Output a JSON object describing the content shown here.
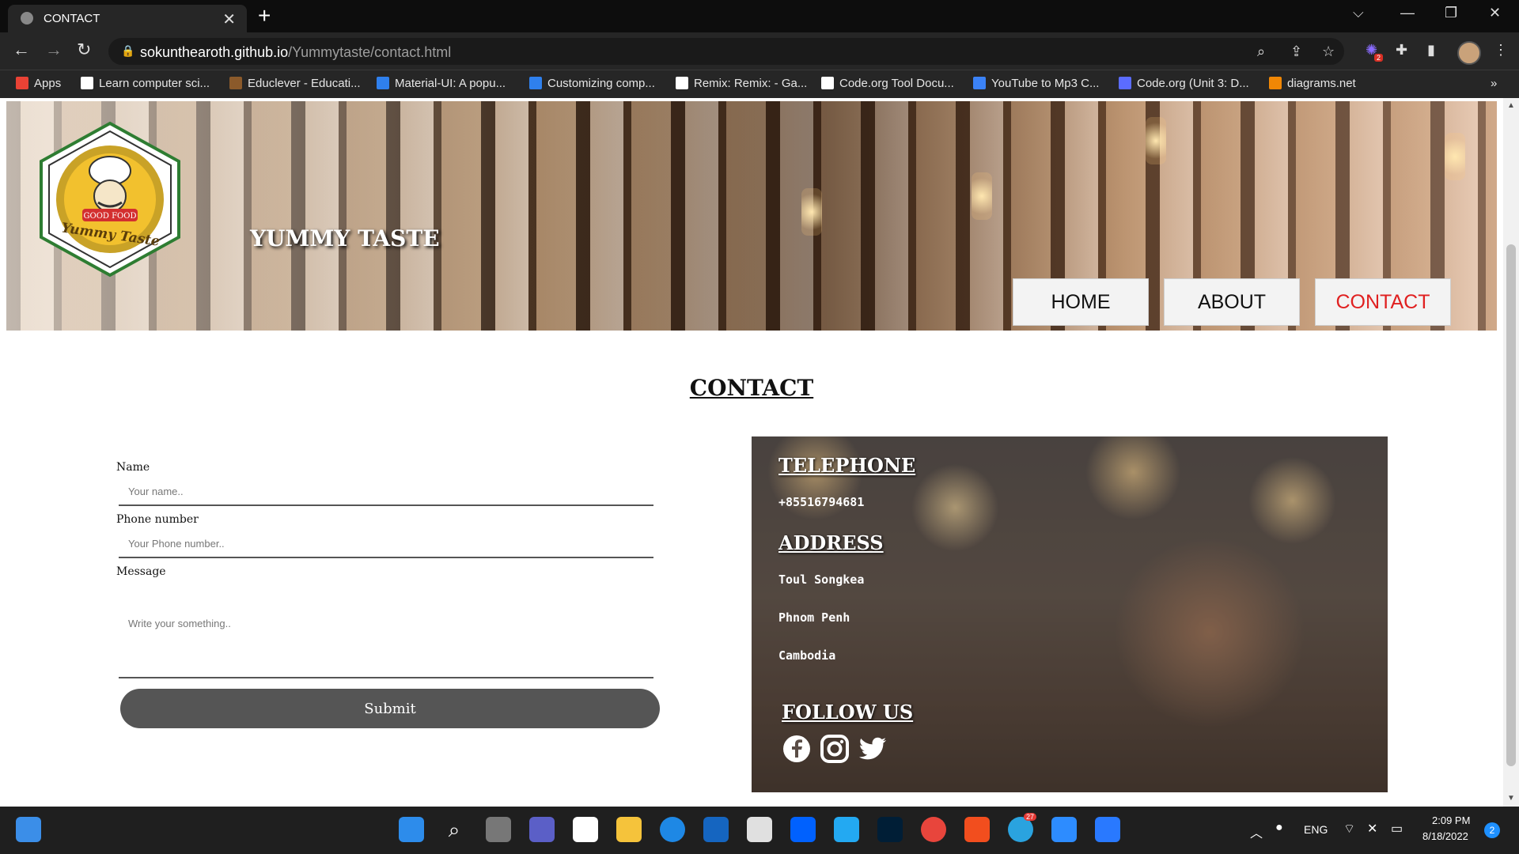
{
  "browser": {
    "tab_title": "CONTACT",
    "url_host": "sokunthearoth.github.io",
    "url_path": "/Yummytaste/contact.html",
    "bookmarks": [
      {
        "label": "Apps",
        "color": "#e94235"
      },
      {
        "label": "Learn computer sci...",
        "color": "#ffffff"
      },
      {
        "label": "Educlever - Educati...",
        "color": "#8b5a2b"
      },
      {
        "label": "Material-UI: A popu...",
        "color": "#2f80ed"
      },
      {
        "label": "Customizing comp...",
        "color": "#2f80ed"
      },
      {
        "label": "Remix: Remix: - Ga...",
        "color": "#ffffff"
      },
      {
        "label": "Code.org Tool Docu...",
        "color": "#ffffff"
      },
      {
        "label": "YouTube to Mp3 C...",
        "color": "#3b82f6"
      },
      {
        "label": "Code.org (Unit 3: D...",
        "color": "#5b6cff"
      },
      {
        "label": "diagrams.net",
        "color": "#f08705"
      }
    ],
    "extension_badge": "2"
  },
  "site": {
    "brand": "YUMMY TASTE",
    "logo_text_top": "GOOD FOOD",
    "logo_text_bottom": "Yummy Taste",
    "nav": [
      {
        "label": "HOME",
        "active": false
      },
      {
        "label": "ABOUT",
        "active": false
      },
      {
        "label": "CONTACT",
        "active": true
      }
    ],
    "accent_color": "#e02020"
  },
  "contact": {
    "heading": "CONTACT",
    "form": {
      "name_label": "Name",
      "name_placeholder": "Your name..",
      "phone_label": "Phone number",
      "phone_placeholder": "Your Phone number..",
      "message_label": "Message",
      "message_placeholder": "Write your something..",
      "submit_label": "Submit"
    },
    "info": {
      "telephone_title": "TELEPHONE",
      "telephone": "+85516794681",
      "address_title": "ADDRESS",
      "address_lines": [
        "Toul Songkea",
        "Phnom Penh",
        "Cambodia"
      ],
      "follow_title": "FOLLOW US",
      "social_icons": [
        "facebook-icon",
        "instagram-icon",
        "twitter-icon"
      ]
    }
  },
  "taskbar": {
    "language": "ENG",
    "time": "2:09 PM",
    "date": "8/18/2022",
    "notification_count": "2",
    "telegram_badge": "27"
  }
}
